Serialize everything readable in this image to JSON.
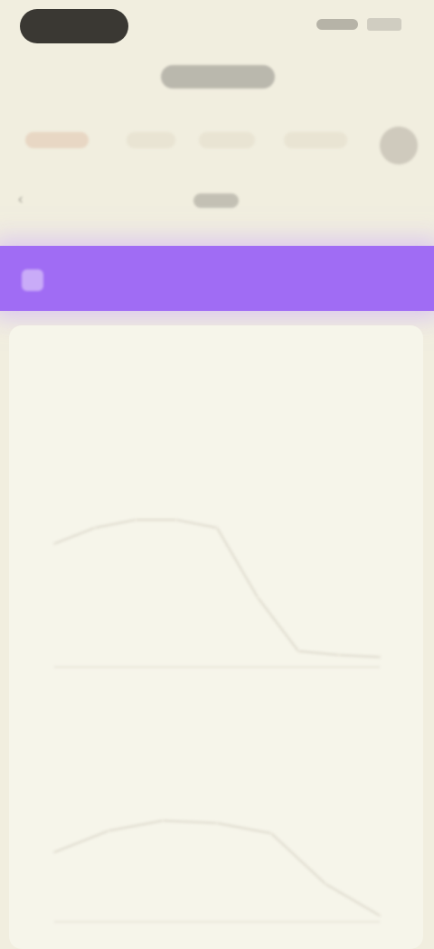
{
  "status": {
    "left_icon": "app-pill",
    "right_icons": [
      "signal-icon",
      "battery-icon"
    ]
  },
  "header": {
    "title": ""
  },
  "tabs": [
    {
      "label": ""
    },
    {
      "label": ""
    },
    {
      "label": ""
    },
    {
      "label": ""
    }
  ],
  "subbar": {
    "label": ""
  },
  "banner": {
    "label": ""
  },
  "card": {
    "title": "",
    "subtitle": "",
    "chart_caption": ""
  },
  "colors": {
    "background": "#F1EEDF",
    "banner": "#A06CF4",
    "card": "#F6F5EA",
    "active_tab": "#C28E67",
    "line": "#E5E2D6"
  },
  "chart_data": [
    {
      "type": "line",
      "title": "",
      "xlabel": "",
      "ylabel": "",
      "x": [
        0,
        1,
        2,
        3,
        4,
        5,
        6,
        7,
        8
      ],
      "series": [
        {
          "values": [
            0.62,
            0.7,
            0.74,
            0.74,
            0.7,
            0.35,
            0.08,
            0.06,
            0.05
          ]
        }
      ],
      "ylim": [
        0,
        1
      ],
      "grid": false
    },
    {
      "type": "line",
      "title": "",
      "xlabel": "",
      "ylabel": "",
      "x": [
        0,
        1,
        2,
        3,
        4,
        5,
        6
      ],
      "series": [
        {
          "values": [
            0.55,
            0.72,
            0.8,
            0.78,
            0.7,
            0.3,
            0.05
          ]
        }
      ],
      "ylim": [
        0,
        1
      ],
      "grid": false
    }
  ]
}
